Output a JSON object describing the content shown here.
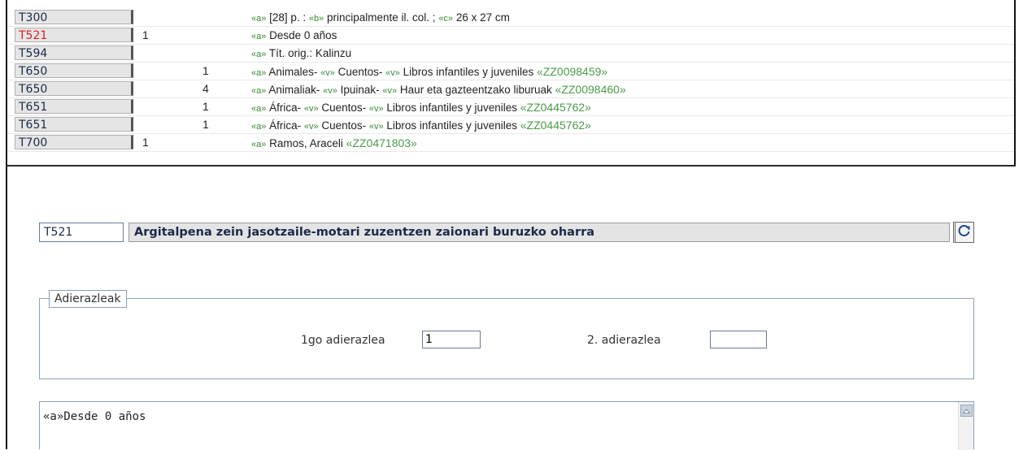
{
  "records": [
    {
      "tag": "T300",
      "ind1": "",
      "ind2": "",
      "parts": [
        {
          "t": "sf",
          "v": "«a»"
        },
        {
          "t": "txt",
          "v": " [28] p. : "
        },
        {
          "t": "sf",
          "v": "«b»"
        },
        {
          "t": "txt",
          "v": " principalmente il. col. ; "
        },
        {
          "t": "sf",
          "v": "«c»"
        },
        {
          "t": "txt",
          "v": " 26 x 27 cm"
        }
      ]
    },
    {
      "tag": "T521",
      "active": true,
      "ind1": "1",
      "ind2": "",
      "parts": [
        {
          "t": "sf",
          "v": "«a»"
        },
        {
          "t": "txt",
          "v": " Desde 0 años"
        }
      ]
    },
    {
      "tag": "T594",
      "ind1": "",
      "ind2": "",
      "parts": [
        {
          "t": "sf",
          "v": "«a»"
        },
        {
          "t": "txt",
          "v": " Tít. orig.: Kalinzu"
        }
      ]
    },
    {
      "tag": "T650",
      "ind1": "",
      "ind2": "1",
      "parts": [
        {
          "t": "sf",
          "v": "«a»"
        },
        {
          "t": "txt",
          "v": " Animales- "
        },
        {
          "t": "sf",
          "v": "«v»"
        },
        {
          "t": "txt",
          "v": " Cuentos- "
        },
        {
          "t": "sf",
          "v": "«v»"
        },
        {
          "t": "txt",
          "v": " Libros infantiles y juveniles "
        },
        {
          "t": "auth",
          "v": "«ZZ0098459»"
        }
      ]
    },
    {
      "tag": "T650",
      "ind1": "",
      "ind2": "4",
      "parts": [
        {
          "t": "sf",
          "v": "«a»"
        },
        {
          "t": "txt",
          "v": " Animaliak- "
        },
        {
          "t": "sf",
          "v": "«v»"
        },
        {
          "t": "txt",
          "v": " Ipuinak- "
        },
        {
          "t": "sf",
          "v": "«v»"
        },
        {
          "t": "txt",
          "v": " Haur eta gazteentzako liburuak "
        },
        {
          "t": "auth",
          "v": "«ZZ0098460»"
        }
      ]
    },
    {
      "tag": "T651",
      "ind1": "",
      "ind2": "1",
      "parts": [
        {
          "t": "sf",
          "v": "«a»"
        },
        {
          "t": "txt",
          "v": " África- "
        },
        {
          "t": "sf",
          "v": "«v»"
        },
        {
          "t": "txt",
          "v": " Cuentos- "
        },
        {
          "t": "sf",
          "v": "«v»"
        },
        {
          "t": "txt",
          "v": " Libros infantiles y juveniles "
        },
        {
          "t": "auth",
          "v": "«ZZ0445762»"
        }
      ]
    },
    {
      "tag": "T651",
      "ind1": "",
      "ind2": "1",
      "parts": [
        {
          "t": "sf",
          "v": "«a»"
        },
        {
          "t": "txt",
          "v": " África- "
        },
        {
          "t": "sf",
          "v": "«v»"
        },
        {
          "t": "txt",
          "v": " Cuentos- "
        },
        {
          "t": "sf",
          "v": "«v»"
        },
        {
          "t": "txt",
          "v": " Libros infantiles y juveniles "
        },
        {
          "t": "auth",
          "v": "«ZZ0445762»"
        }
      ]
    },
    {
      "tag": "T700",
      "ind1": "1",
      "ind2": "",
      "parts": [
        {
          "t": "sf",
          "v": "«a»"
        },
        {
          "t": "txt",
          "v": " Ramos, Araceli "
        },
        {
          "t": "auth",
          "v": "«ZZ0471803»"
        }
      ]
    }
  ],
  "editor": {
    "tag": "T521",
    "description": "Argitalpena zein jasotzaile-motari zuzentzen zaionari buruzko oharra",
    "refresh_icon": "refresh-icon"
  },
  "indicators": {
    "legend": "Adierazleak",
    "first_label": "1go adierazlea",
    "first_value": "1",
    "second_label": "2. adierazlea",
    "second_value": ""
  },
  "content": {
    "text": "«a»Desde 0 años"
  },
  "colors": {
    "active_tag": "#e02020",
    "subfield": "#3a8a3a",
    "authority": "#4a9a4a"
  }
}
